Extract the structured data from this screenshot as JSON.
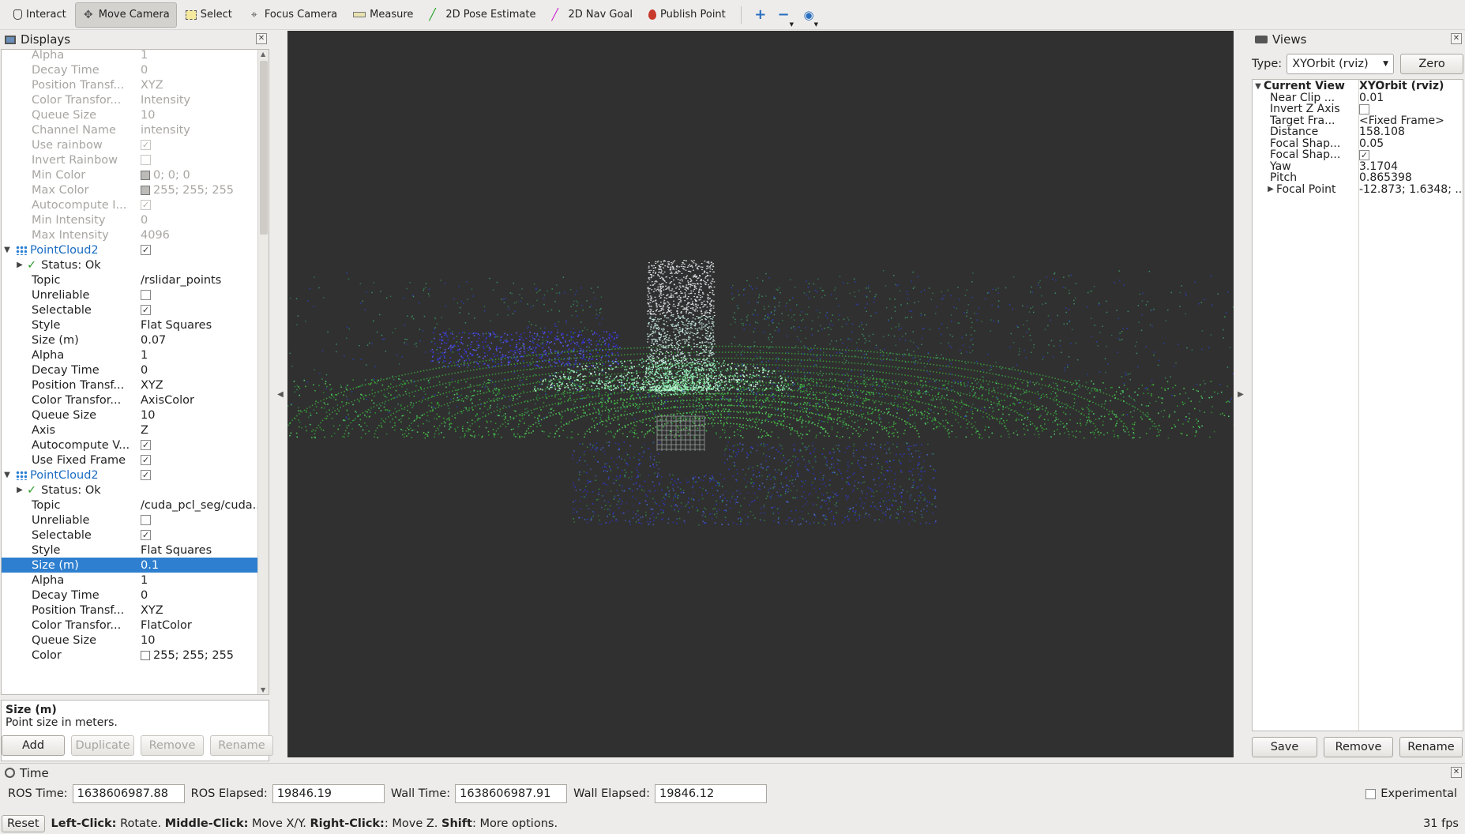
{
  "toolbar": {
    "tools": [
      {
        "label": "Interact",
        "icon": "hand-icon",
        "active": false
      },
      {
        "label": "Move Camera",
        "icon": "move-camera-icon",
        "active": true
      },
      {
        "label": "Select",
        "icon": "select-box-icon",
        "active": false
      },
      {
        "label": "Focus Camera",
        "icon": "focus-crosshair-icon",
        "active": false
      },
      {
        "label": "Measure",
        "icon": "ruler-icon",
        "active": false
      },
      {
        "label": "2D Pose Estimate",
        "icon": "pose-arrow-green-icon",
        "active": false
      },
      {
        "label": "2D Nav Goal",
        "icon": "nav-arrow-magenta-icon",
        "active": false
      },
      {
        "label": "Publish Point",
        "icon": "map-pin-icon",
        "active": false
      }
    ]
  },
  "displays": {
    "title": "Displays",
    "rows": [
      {
        "k": "Alpha",
        "v": "1",
        "dim": true,
        "indent": 2
      },
      {
        "k": "Decay Time",
        "v": "0",
        "dim": true,
        "indent": 2
      },
      {
        "k": "Position Transf...",
        "v": "XYZ",
        "dim": true,
        "indent": 2
      },
      {
        "k": "Color Transfor...",
        "v": "Intensity",
        "dim": true,
        "indent": 2
      },
      {
        "k": "Queue Size",
        "v": "10",
        "dim": true,
        "indent": 2
      },
      {
        "k": "Channel Name",
        "v": "intensity",
        "dim": true,
        "indent": 2
      },
      {
        "k": "Use rainbow",
        "check": true,
        "dim": true,
        "indent": 2
      },
      {
        "k": "Invert Rainbow",
        "check": false,
        "dim": true,
        "indent": 2
      },
      {
        "k": "Min Color",
        "v": "0; 0; 0",
        "swatch": "#bdbbb8",
        "dim": true,
        "indent": 2
      },
      {
        "k": "Max Color",
        "v": "255; 255; 255",
        "swatch": "#bdbbb8",
        "dim": true,
        "indent": 2
      },
      {
        "k": "Autocompute I...",
        "check": true,
        "dim": true,
        "indent": 2
      },
      {
        "k": "Min Intensity",
        "v": "0",
        "dim": true,
        "indent": 2
      },
      {
        "k": "Max Intensity",
        "v": "4096",
        "dim": true,
        "indent": 2
      },
      {
        "k": "PointCloud2",
        "check": true,
        "group": true,
        "expand": "down",
        "indent": 0
      },
      {
        "k": "Status: Ok",
        "status": true,
        "expand": "right",
        "indent": 1
      },
      {
        "k": "Topic",
        "v": "/rslidar_points",
        "indent": 2
      },
      {
        "k": "Unreliable",
        "check": false,
        "indent": 2
      },
      {
        "k": "Selectable",
        "check": true,
        "indent": 2
      },
      {
        "k": "Style",
        "v": "Flat Squares",
        "indent": 2
      },
      {
        "k": "Size (m)",
        "v": "0.07",
        "indent": 2
      },
      {
        "k": "Alpha",
        "v": "1",
        "indent": 2
      },
      {
        "k": "Decay Time",
        "v": "0",
        "indent": 2
      },
      {
        "k": "Position Transf...",
        "v": "XYZ",
        "indent": 2
      },
      {
        "k": "Color Transfor...",
        "v": "AxisColor",
        "indent": 2
      },
      {
        "k": "Queue Size",
        "v": "10",
        "indent": 2
      },
      {
        "k": "Axis",
        "v": "Z",
        "indent": 2
      },
      {
        "k": "Autocompute V...",
        "check": true,
        "indent": 2
      },
      {
        "k": "Use Fixed Frame",
        "check": true,
        "indent": 2
      },
      {
        "k": "PointCloud2",
        "check": true,
        "group": true,
        "expand": "down",
        "indent": 0
      },
      {
        "k": "Status: Ok",
        "status": true,
        "expand": "right",
        "indent": 1
      },
      {
        "k": "Topic",
        "v": "/cuda_pcl_seg/cuda...",
        "indent": 2
      },
      {
        "k": "Unreliable",
        "check": false,
        "indent": 2
      },
      {
        "k": "Selectable",
        "check": true,
        "indent": 2
      },
      {
        "k": "Style",
        "v": "Flat Squares",
        "indent": 2
      },
      {
        "k": "Size (m)",
        "v": "0.1",
        "selected": true,
        "indent": 2
      },
      {
        "k": "Alpha",
        "v": "1",
        "indent": 2
      },
      {
        "k": "Decay Time",
        "v": "0",
        "indent": 2
      },
      {
        "k": "Position Transf...",
        "v": "XYZ",
        "indent": 2
      },
      {
        "k": "Color Transfor...",
        "v": "FlatColor",
        "indent": 2
      },
      {
        "k": "Queue Size",
        "v": "10",
        "indent": 2
      },
      {
        "k": "Color",
        "v": "255; 255; 255",
        "swatch": "#ffffff",
        "indent": 2
      }
    ],
    "desc_title": "Size (m)",
    "desc_text": "Point size in meters.",
    "buttons": [
      "Add",
      "Duplicate",
      "Remove",
      "Rename"
    ]
  },
  "views": {
    "title": "Views",
    "type_label": "Type:",
    "type_value": "XYOrbit (rviz)",
    "zero_label": "Zero",
    "rows": [
      {
        "k": "Current View",
        "v": "XYOrbit (rviz)",
        "bold": true,
        "expand": "down",
        "indent": 0
      },
      {
        "k": "Near Clip ...",
        "v": "0.01",
        "indent": 1
      },
      {
        "k": "Invert Z Axis",
        "check": false,
        "indent": 1
      },
      {
        "k": "Target Fra...",
        "v": "<Fixed Frame>",
        "indent": 1
      },
      {
        "k": "Distance",
        "v": "158.108",
        "indent": 1
      },
      {
        "k": "Focal Shap...",
        "v": "0.05",
        "indent": 1
      },
      {
        "k": "Focal Shap...",
        "check": true,
        "indent": 1
      },
      {
        "k": "Yaw",
        "v": "3.1704",
        "indent": 1
      },
      {
        "k": "Pitch",
        "v": "0.865398",
        "indent": 1
      },
      {
        "k": "Focal Point",
        "v": "-12.873; 1.6348; ...",
        "expand": "right",
        "indent": 1
      }
    ],
    "buttons": [
      "Save",
      "Remove",
      "Rename"
    ]
  },
  "time": {
    "title": "Time",
    "ros_time_label": "ROS Time:",
    "ros_time": "1638606987.88",
    "ros_elapsed_label": "ROS Elapsed:",
    "ros_elapsed": "19846.19",
    "wall_time_label": "Wall Time:",
    "wall_time": "1638606987.91",
    "wall_elapsed_label": "Wall Elapsed:",
    "wall_elapsed": "19846.12",
    "experimental_label": "Experimental"
  },
  "status": {
    "reset_label": "Reset",
    "hint_parts": [
      {
        "b": "Left-Click:",
        "t": " Rotate. "
      },
      {
        "b": "Middle-Click:",
        "t": " Move X/Y. "
      },
      {
        "b": "Right-Click:",
        "t": ": Move Z. "
      },
      {
        "b": "Shift",
        "t": ": More options."
      }
    ],
    "fps": "31 fps"
  },
  "colors": {
    "selection": "#2e7fcf",
    "group_text": "#1b6cc2",
    "viewport_bg": "#303030"
  }
}
